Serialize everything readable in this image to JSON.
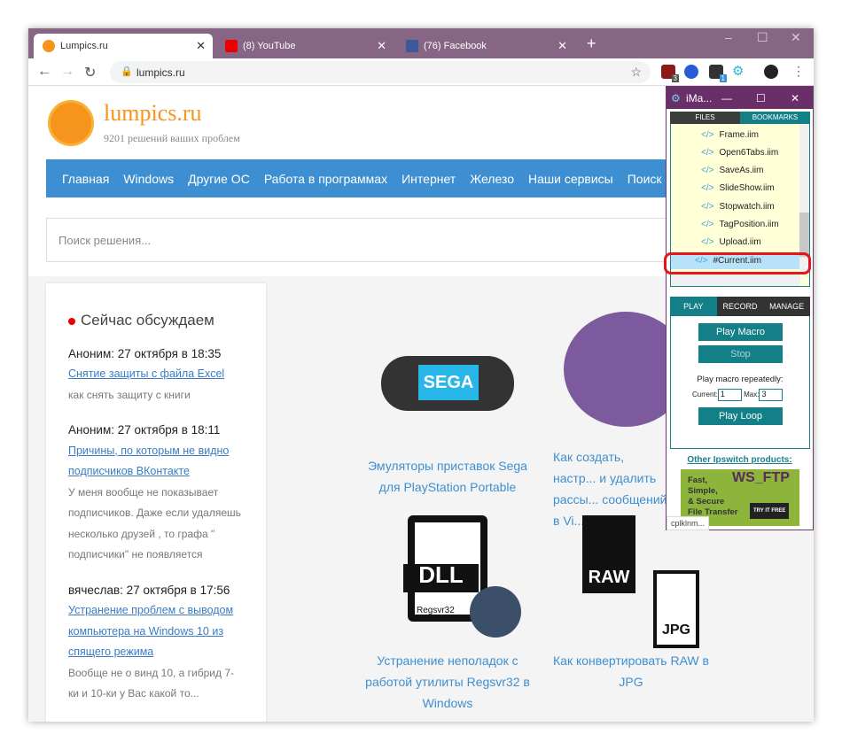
{
  "browser": {
    "tabs": [
      {
        "label": "Lumpics.ru",
        "active": true
      },
      {
        "label": "(8) YouTube",
        "active": false
      },
      {
        "label": "(76) Facebook",
        "active": false
      }
    ],
    "new_tab": "+",
    "url": "lumpics.ru",
    "extension_badges": [
      "3",
      "1"
    ]
  },
  "site": {
    "name": "lumpics.ru",
    "tagline": "9201 решений ваших проблем",
    "menu": [
      "Главная",
      "Windows",
      "Другие ОС",
      "Работа в программах",
      "Интернет",
      "Железо",
      "Наши сервисы",
      "Поиск Go"
    ],
    "search_placeholder": "Поиск решения...",
    "sidebar": {
      "title": "Сейчас обсуждаем",
      "comments": [
        {
          "author": "Аноним: 27 октября в 18:35",
          "link": "Снятие защиты с файла Excel",
          "text": "как снять защиту с книги"
        },
        {
          "author": "Аноним: 27 октября в 18:11",
          "link": "Причины, по которым не видно подписчиков ВКонтакте",
          "text": "У меня вообще не показывает подписчиков. Даже если удаляешь несколько друзей , то графа \" подписчики\" не появляется"
        },
        {
          "author": "вячеслав: 27 октября в 17:56",
          "link": "Устранение проблем с выводом компьютера на Windows 10 из спящего режима",
          "text": "Вообще не о винд 10, а гибрид 7-ки и 10-ки у Вас какой то..."
        }
      ]
    },
    "articles": [
      {
        "title": "Эмуляторы приставок Sega для PlayStation Portable",
        "image_text": "SEGA"
      },
      {
        "title": "Как создать, настр... и удалить рассы... сообщений в Vi..."
      },
      {
        "title": "Устранение неполадок с работой утилиты Regsvr32 в Windows",
        "image_text": "DLL",
        "image_subtext": "Regsvr32"
      },
      {
        "title": "Как конвертировать RAW в JPG",
        "image_text": "RAW",
        "image_subtext": "JPG"
      }
    ]
  },
  "imacros": {
    "title": "iMa...",
    "tabs": [
      "FILES",
      "BOOKMARKS"
    ],
    "files": [
      "Frame.iim",
      "Open6Tabs.iim",
      "SaveAs.iim",
      "SlideShow.iim",
      "Stopwatch.iim",
      "TagPosition.iim",
      "Upload.iim",
      "#Current.iim"
    ],
    "selected_file": "#Current.iim",
    "action_tabs": [
      "PLAY",
      "RECORD",
      "MANAGE"
    ],
    "play_macro": "Play Macro",
    "stop": "Stop",
    "repeat_label": "Play macro repeatedly:",
    "current_label": "Current:",
    "current_value": "1",
    "max_label": "Max:",
    "max_value": "3",
    "play_loop": "Play Loop",
    "other_products": "Other Ipswitch products:",
    "ad_lines": [
      "Fast,",
      "Simple,",
      "& Secure",
      "File Transfer"
    ],
    "ad_logo": "WS_FTP",
    "ad_button": "TRY IT FREE",
    "status": "cplklnm..."
  },
  "colors": {
    "tabbar": "#876584",
    "menu": "#3e8fd1",
    "accent": "#f7941d",
    "imacros_teal": "#137f86",
    "imacros_title": "#6a2f68",
    "highlight": "#e3161c"
  }
}
